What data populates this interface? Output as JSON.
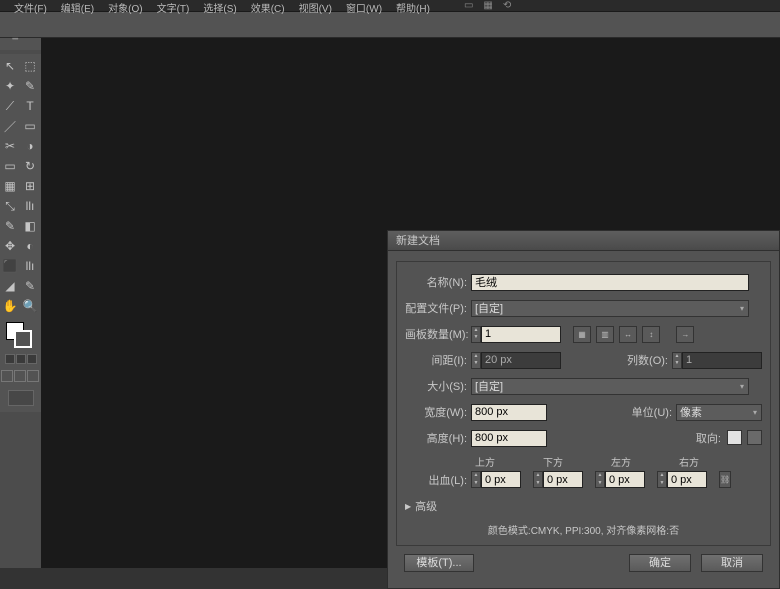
{
  "menu": {
    "items": [
      "文件(F)",
      "编辑(E)",
      "对象(O)",
      "文字(T)",
      "选择(S)",
      "效果(C)",
      "视图(V)",
      "窗口(W)",
      "帮助(H)"
    ]
  },
  "tools": {
    "items": [
      "↖",
      "⬚",
      "✦",
      "✎",
      "⟋",
      "T",
      "／",
      "▭",
      "✂",
      "◑",
      "▭",
      "↻",
      "▦",
      "⊞",
      "⤡",
      "llı",
      "✎",
      "◧",
      "✥",
      "◐",
      "⬛",
      "llı",
      "◢",
      "✎",
      "✋",
      "🔍"
    ]
  },
  "dialog": {
    "title": "新建文档",
    "name_lbl": "名称(N):",
    "name_val": "毛绒",
    "profile_lbl": "配置文件(P):",
    "profile_val": "[自定]",
    "artboards_lbl": "画板数量(M):",
    "artboards_val": "1",
    "spacing_lbl": "间距(I):",
    "spacing_val": "20 px",
    "cols_lbl": "列数(O):",
    "cols_val": "1",
    "size_lbl": "大小(S):",
    "size_val": "[自定]",
    "width_lbl": "宽度(W):",
    "width_val": "800 px",
    "units_lbl": "单位(U):",
    "units_val": "像素",
    "height_lbl": "高度(H):",
    "height_val": "800 px",
    "orient_lbl": "取向:",
    "bleed_lbl": "出血(L):",
    "bleed_hdr": [
      "上方",
      "下方",
      "左方",
      "右方"
    ],
    "bleed_vals": [
      "0 px",
      "0 px",
      "0 px",
      "0 px"
    ],
    "advanced": "高级",
    "summary": "颜色模式:CMYK, PPI:300, 对齐像素网格:否",
    "tpl_btn": "模板(T)...",
    "ok_btn": "确定",
    "cancel_btn": "取消"
  }
}
